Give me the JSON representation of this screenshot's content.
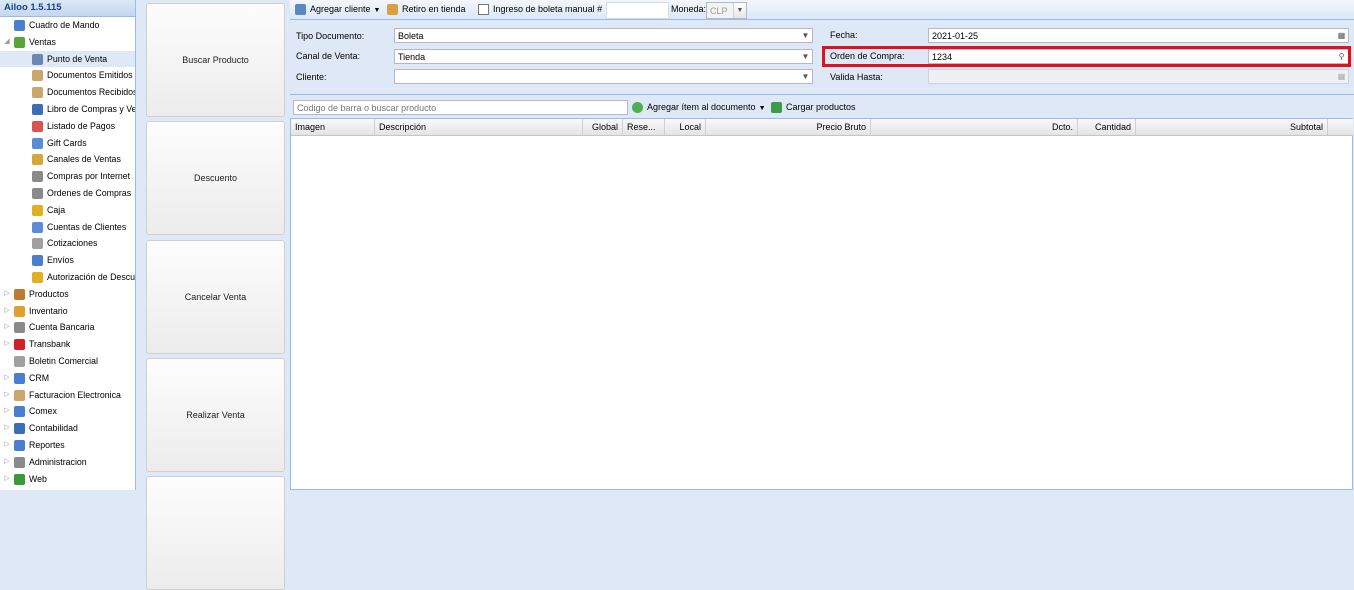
{
  "app": {
    "title": "Ailoo 1.5.115"
  },
  "sidebar": {
    "items": [
      {
        "label": "Cuadro de Mando",
        "level": 0,
        "expander": "",
        "icon": "bar-chart-icon",
        "color": "#4a7fd0"
      },
      {
        "label": "Ventas",
        "level": 0,
        "expander": "expanded",
        "icon": "money-icon",
        "color": "#5aa53a"
      },
      {
        "label": "Punto de Venta",
        "level": 1,
        "expander": "",
        "icon": "cash-register-icon",
        "color": "#6b87b0",
        "selected": true
      },
      {
        "label": "Documentos Emitidos",
        "level": 1,
        "expander": "",
        "icon": "document-icon",
        "color": "#c9a66b"
      },
      {
        "label": "Documentos Recibidos",
        "level": 1,
        "expander": "",
        "icon": "document-icon",
        "color": "#c9a66b"
      },
      {
        "label": "Libro de Compras y Ventas",
        "level": 1,
        "expander": "",
        "icon": "book-icon",
        "color": "#3a6fb5"
      },
      {
        "label": "Listado de Pagos",
        "level": 1,
        "expander": "",
        "icon": "list-icon",
        "color": "#d9534f"
      },
      {
        "label": "Gift Cards",
        "level": 1,
        "expander": "",
        "icon": "card-icon",
        "color": "#5b8dd6"
      },
      {
        "label": "Canales de Ventas",
        "level": 1,
        "expander": "",
        "icon": "cart-icon",
        "color": "#d8a53a"
      },
      {
        "label": "Compras por Internet",
        "level": 1,
        "expander": "",
        "icon": "cart-icon",
        "color": "#8a8a8a"
      },
      {
        "label": "Ordenes de Compras",
        "level": 1,
        "expander": "",
        "icon": "cart-icon",
        "color": "#8a8a8a"
      },
      {
        "label": "Caja",
        "level": 1,
        "expander": "",
        "icon": "coins-icon",
        "color": "#e0b020"
      },
      {
        "label": "Cuentas de Clientes",
        "level": 1,
        "expander": "",
        "icon": "card-icon",
        "color": "#5b8dd6"
      },
      {
        "label": "Cotizaciones",
        "level": 1,
        "expander": "",
        "icon": "document-icon",
        "color": "#a0a0a0"
      },
      {
        "label": "Envíos",
        "level": 1,
        "expander": "",
        "icon": "truck-icon",
        "color": "#4a7fd0"
      },
      {
        "label": "Autorización de Descuentos",
        "level": 1,
        "expander": "",
        "icon": "folder-icon",
        "color": "#e0b020"
      },
      {
        "label": "Productos",
        "level": 0,
        "expander": "collapsed",
        "icon": "box-icon",
        "color": "#c07a30"
      },
      {
        "label": "Inventario",
        "level": 0,
        "expander": "collapsed",
        "icon": "package-icon",
        "color": "#e0a030"
      },
      {
        "label": "Cuenta Bancaria",
        "level": 0,
        "expander": "collapsed",
        "icon": "bank-icon",
        "color": "#8a8a8a"
      },
      {
        "label": "Transbank",
        "level": 0,
        "expander": "collapsed",
        "icon": "transbank-icon",
        "color": "#d0202a"
      },
      {
        "label": "Boletin Comercial",
        "level": 0,
        "expander": "",
        "icon": "tag-icon",
        "color": "#a0a0a0"
      },
      {
        "label": "CRM",
        "level": 0,
        "expander": "collapsed",
        "icon": "users-icon",
        "color": "#4a7fd0"
      },
      {
        "label": "Facturacion Electronica",
        "level": 0,
        "expander": "collapsed",
        "icon": "invoice-icon",
        "color": "#c9a66b"
      },
      {
        "label": "Comex",
        "level": 0,
        "expander": "collapsed",
        "icon": "truck-icon",
        "color": "#4a7fd0"
      },
      {
        "label": "Contabilidad",
        "level": 0,
        "expander": "collapsed",
        "icon": "ledger-icon",
        "color": "#3a6fb5"
      },
      {
        "label": "Reportes",
        "level": 0,
        "expander": "collapsed",
        "icon": "bar-chart-icon",
        "color": "#4a7fd0"
      },
      {
        "label": "Administracion",
        "level": 0,
        "expander": "collapsed",
        "icon": "gear-icon",
        "color": "#8a8a8a"
      },
      {
        "label": "Web",
        "level": 0,
        "expander": "collapsed",
        "icon": "globe-icon",
        "color": "#3a9a3a"
      }
    ]
  },
  "actions": {
    "buscar": "Buscar Producto",
    "descuento": "Descuento",
    "cancelar": "Cancelar Venta",
    "realizar": "Realizar Venta"
  },
  "toolbar": {
    "agregar_cliente": "Agregar cliente",
    "retiro": "Retiro en tienda",
    "boleta_manual": "Ingreso de boleta manual #",
    "boleta_manual_value": "",
    "moneda_label": "Moneda:",
    "moneda_value": "CLP"
  },
  "form": {
    "tipo_documento_label": "Tipo Documento:",
    "tipo_documento_value": "Boleta",
    "canal_label": "Canal de Venta:",
    "canal_value": "Tienda",
    "cliente_label": "Cliente:",
    "cliente_value": "",
    "fecha_label": "Fecha:",
    "fecha_value": "2021-01-25",
    "orden_label": "Orden de Compra:",
    "orden_value": "1234",
    "valida_label": "Valida Hasta:",
    "valida_value": ""
  },
  "gridbar": {
    "search_placeholder": "Codigo de barra o buscar producto",
    "agregar_item": "Agregar ítem al documento",
    "cargar": "Cargar productos"
  },
  "grid": {
    "columns": {
      "imagen": "Imagen",
      "descripcion": "Descripción",
      "global": "Global",
      "rese": "Rese...",
      "local": "Local",
      "precio": "Precio Bruto",
      "dcto": "Dcto.",
      "cantidad": "Cantidad",
      "subtotal": "Subtotal"
    }
  },
  "colors": {
    "highlight": "#e0101c",
    "panel_bg": "#dfe8f6",
    "border": "#99bbe8"
  }
}
